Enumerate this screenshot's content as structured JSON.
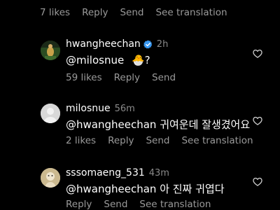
{
  "top_actions": {
    "likes": "7 likes",
    "reply": "Reply",
    "send": "Send",
    "translate": "See translation"
  },
  "comments": [
    {
      "username": "hwangheechan",
      "verified": true,
      "time": "2h",
      "mention": "@milosnue",
      "emoji": "🐣",
      "suffix": "?",
      "likes": "59 likes",
      "reply": "Reply",
      "send": "Send"
    },
    {
      "username": "milosnue",
      "time": "56m",
      "mention": "@hwangheechan",
      "text": " 귀여운데 잘생겼어요",
      "likes": "2 likes",
      "reply": "Reply",
      "send": "Send",
      "translate": "See translation"
    },
    {
      "username": "sssomaeng_531",
      "time": "43m",
      "mention": "@hwangheechan",
      "text": " 아 진짜 귀엽다",
      "reply": "Reply",
      "send": "Send",
      "translate": "See translation"
    }
  ],
  "colors": {
    "background": "#000000",
    "muted": "#9a9a9a",
    "verified": "#3897f0"
  }
}
